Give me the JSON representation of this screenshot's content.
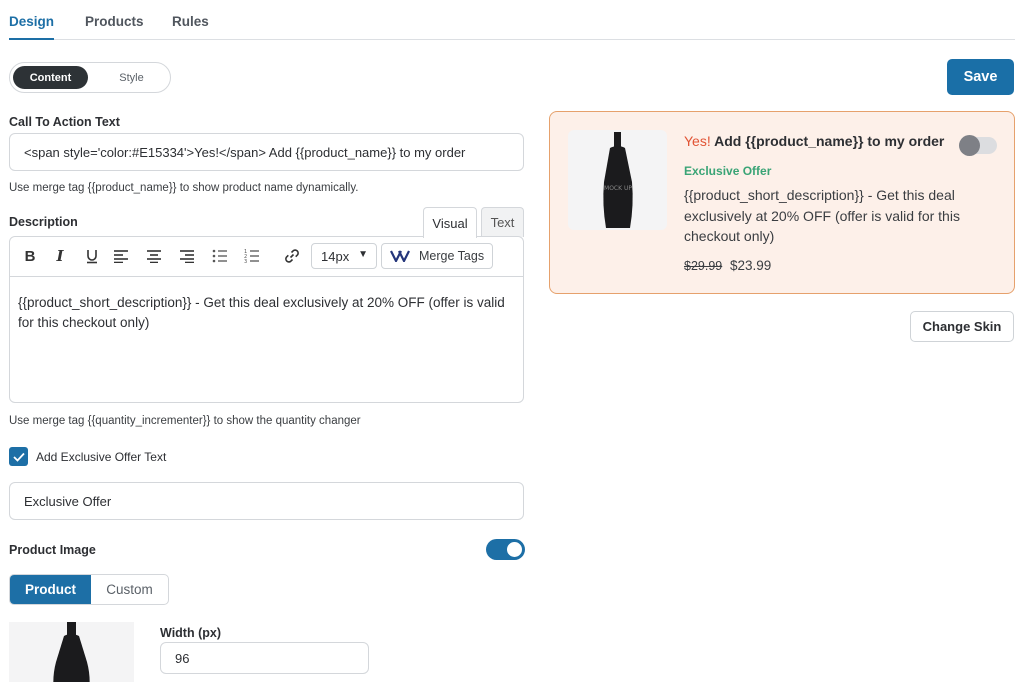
{
  "tabs": [
    {
      "label": "Design"
    },
    {
      "label": "Products"
    },
    {
      "label": "Rules"
    }
  ],
  "mode_toggle": {
    "content": "Content",
    "style": "Style"
  },
  "save_label": "Save",
  "cta": {
    "label": "Call To Action Text",
    "value": "<span style='color:#E15334'>Yes!</span> Add {{product_name}} to my order",
    "help": "Use merge tag {{product_name}} to show product name dynamically."
  },
  "description": {
    "label": "Description",
    "tab_visual": "Visual",
    "tab_text": "Text",
    "font_size": "14px",
    "merge_tags": "Merge Tags",
    "body": "{{product_short_description}} - Get this deal exclusively at 20% OFF (offer is valid for this checkout only)",
    "help": "Use merge tag {{quantity_incrementer}} to show the quantity changer"
  },
  "exclusive": {
    "checkbox_label": "Add Exclusive Offer Text",
    "checked": true,
    "value": "Exclusive Offer"
  },
  "product_image": {
    "label": "Product Image",
    "enabled": true,
    "source_product": "Product",
    "source_custom": "Custom",
    "width_label": "Width (px)",
    "width_value": "96"
  },
  "preview": {
    "yes": "Yes!",
    "title_rest": " Add {{product_name}} to my order",
    "offer": "Exclusive Offer",
    "description": "{{product_short_description}} - Get this deal exclusively at 20% OFF (offer is valid for this checkout only)",
    "old_price": "$29.99",
    "new_price": "$23.99",
    "bottle_text": "MOCK UP"
  },
  "change_skin_label": "Change Skin",
  "colors": {
    "accent": "#1d6fa6",
    "yes_red": "#E15334",
    "offer_green": "#3aa476",
    "preview_bg": "#fdf0e9",
    "preview_border": "#e6a16c"
  },
  "icons": [
    "bold-icon",
    "italic-icon",
    "underline-icon",
    "align-left-icon",
    "align-center-icon",
    "align-right-icon",
    "bullet-list-icon",
    "numbered-list-icon",
    "link-icon",
    "merge-tags-icon",
    "checkmark-icon"
  ]
}
